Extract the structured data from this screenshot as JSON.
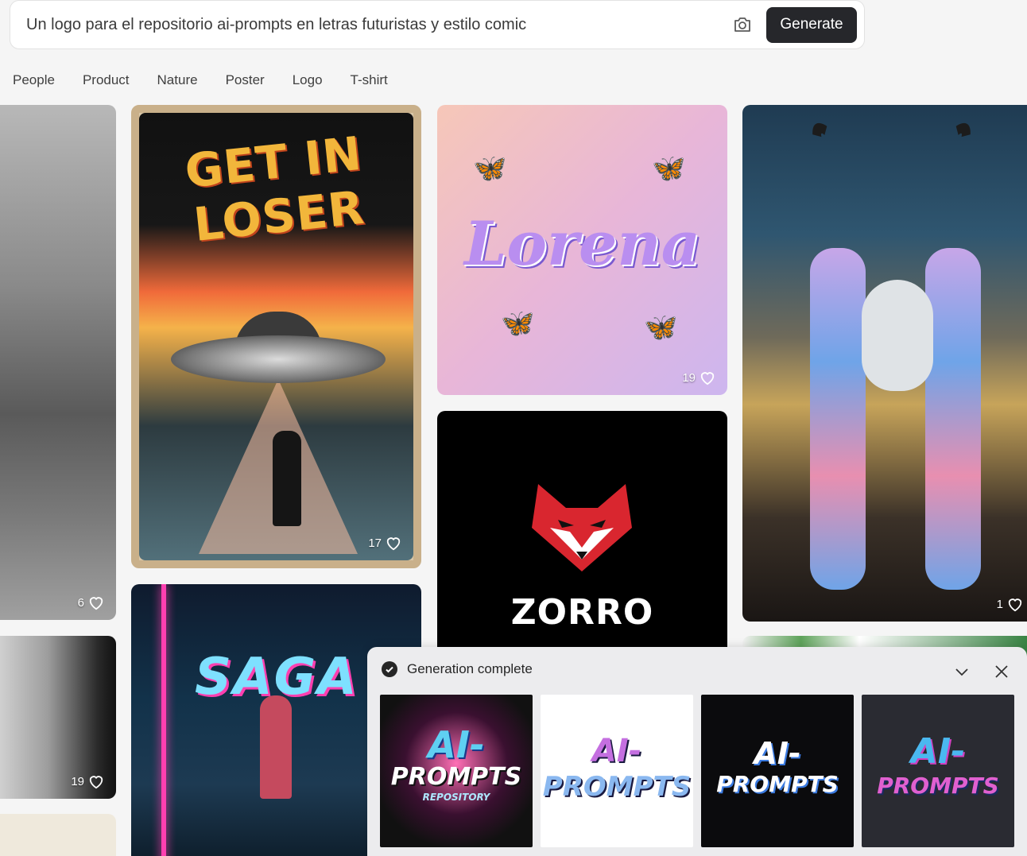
{
  "prompt": {
    "value": "Un logo para el repositorio ai-prompts en letras futuristas y estilo comic",
    "generate_label": "Generate",
    "camera_icon": "camera-icon"
  },
  "categories": [
    "People",
    "Product",
    "Nature",
    "Poster",
    "Logo",
    "T-shirt"
  ],
  "cards": {
    "left_top_likes": "6",
    "left_mid_likes": "19",
    "loser": {
      "title": "GET IN LOSER",
      "likes": "17"
    },
    "lorena": {
      "title": "Lorena",
      "likes": "19"
    },
    "zorro": {
      "title": "ZORRO"
    },
    "demon": {
      "likes": "1"
    },
    "saga": {
      "title": "SAGA"
    }
  },
  "generation": {
    "status": "Generation complete",
    "results": [
      {
        "line1": "AI-",
        "line2": "PROMPTS",
        "line3": "REPOSITORY"
      },
      {
        "line1": "AI-",
        "line2": "PROMPTS"
      },
      {
        "line1": "AI-",
        "line2": "PROMPTS"
      },
      {
        "line1": "AI-",
        "line2": "PROMPTS"
      }
    ]
  },
  "colors": {
    "background": "#f5f5f5",
    "button_dark": "#26272b",
    "panel": "#ececee"
  }
}
